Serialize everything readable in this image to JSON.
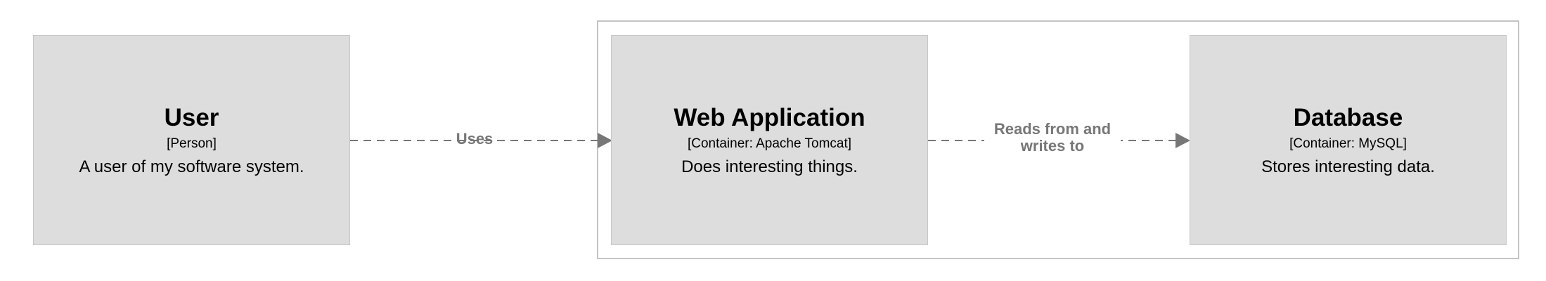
{
  "elements": {
    "user": {
      "name": "User",
      "type": "[Person]",
      "description": "A user of my software system."
    },
    "web_application": {
      "name": "Web Application",
      "type": "[Container: Apache Tomcat]",
      "description": "Does interesting things."
    },
    "database": {
      "name": "Database",
      "type": "[Container: MySQL]",
      "description": "Stores interesting data."
    }
  },
  "relationships": [
    {
      "from": "User",
      "to": "Web Application",
      "label": "Uses"
    },
    {
      "from": "Web Application",
      "to": "Database",
      "label": "Reads from and writes to"
    }
  ],
  "colors": {
    "box_fill": "#dddddd",
    "box_border": "#c6c6c6",
    "boundary_border": "#c4c4c4",
    "relationship": "#777777"
  }
}
